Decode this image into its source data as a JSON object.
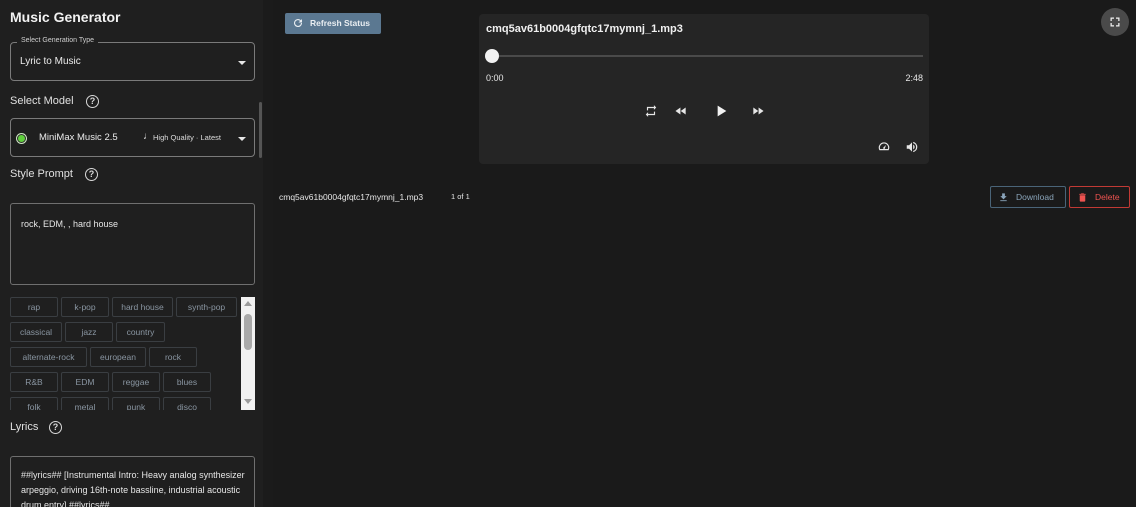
{
  "sidebar": {
    "title": "Music Generator",
    "generation_type": {
      "legend": "Select Generation Type",
      "value": "Lyric to Music"
    },
    "select_model": {
      "label": "Select Model",
      "name": "MiniMax Music 2.5",
      "quality": "High Quality · Latest",
      "status_color": "#5fcf3c"
    },
    "style_prompt": {
      "label": "Style Prompt",
      "value": "rock, EDM, , hard house"
    },
    "style_tags": [
      "rap",
      "k-pop",
      "hard house",
      "synth-pop",
      "classical",
      "jazz",
      "country",
      "alternate-rock",
      "european",
      "rock",
      "R&B",
      "EDM",
      "reggae",
      "blues",
      "folk",
      "metal",
      "punk",
      "disco"
    ],
    "lyrics": {
      "label": "Lyrics",
      "value": "##lyrics## [Instrumental Intro: Heavy analog synthesizer arpeggio, driving 16th-note bassline, industrial acoustic drum entry] ##lyrics##"
    }
  },
  "main": {
    "refresh_label": "Refresh Status",
    "player": {
      "title": "cmq5av61b0004gfqtc17mymnj_1.mp3",
      "current_time": "0:00",
      "duration": "2:48",
      "progress": 0
    },
    "file_name": "cmq5av61b0004gfqtc17mymnj_1.mp3",
    "file_count": "1 of 1",
    "download_label": "Download",
    "delete_label": "Delete"
  },
  "colors": {
    "accent": "#5b7891",
    "delete": "#ef5350",
    "tag_text": "#8a96a2"
  },
  "icons": [
    "help-icon",
    "music-note-icon",
    "refresh-icon",
    "repeat-icon",
    "rewind-icon",
    "play-icon",
    "fast-forward-icon",
    "speed-icon",
    "volume-icon",
    "download-icon",
    "trash-icon",
    "fullscreen-icon"
  ]
}
